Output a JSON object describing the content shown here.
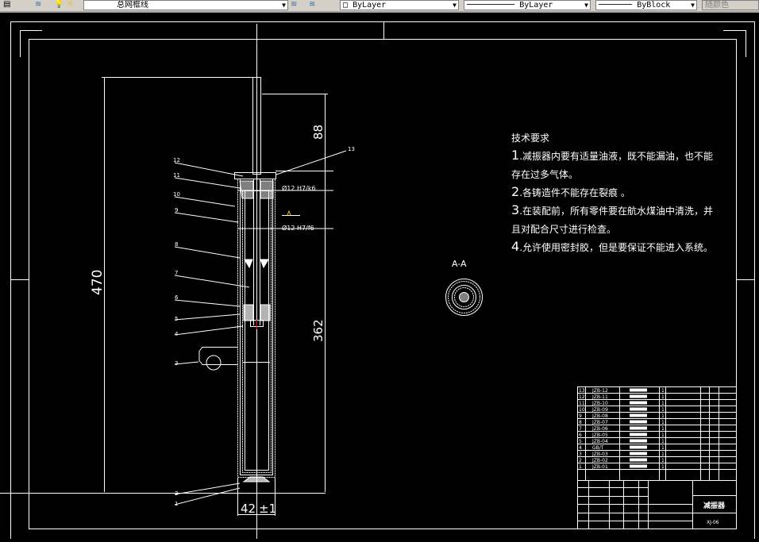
{
  "toolbar": {
    "layer_name": "总网框线",
    "color": "ByLayer",
    "linetype": "ByLayer",
    "lineweight": "ByBlock",
    "plot_style": "随颜色"
  },
  "drawing": {
    "dims": {
      "overall": "470",
      "top": "88",
      "bottom": "362",
      "diameter": "42",
      "tolerance": "±1"
    },
    "fits": {
      "fit1": "Ø12 H7/k6",
      "fit2": "Ø12 H7/f6"
    },
    "section_label": "A-A",
    "balloons": [
      "1",
      "2",
      "3",
      "4",
      "5",
      "6",
      "7",
      "8",
      "9",
      "10",
      "11",
      "12",
      "13"
    ],
    "tech_requirements": {
      "title": "技术要求",
      "items": [
        {
          "num": "1",
          "text": ".减振器内要有适量油液，既不能漏油，也不能"
        },
        {
          "num": "",
          "text": "存在过多气体。"
        },
        {
          "num": "2",
          "text": ".各铸造件不能存在裂痕 。"
        },
        {
          "num": "3",
          "text": ".在装配前，所有零件要在航水煤油中清洗，并"
        },
        {
          "num": "",
          "text": "且对配合尺寸进行检查。"
        },
        {
          "num": "4",
          "text": ".允许使用密封胶，但是要保证不能进入系统。"
        }
      ]
    }
  },
  "title_block": {
    "title": "减振器",
    "drawing_no": "XJ-06",
    "parts": [
      {
        "no": "13",
        "code": "JZB-12",
        "qty": "1"
      },
      {
        "no": "12",
        "code": "JZB-11",
        "qty": "1"
      },
      {
        "no": "11",
        "code": "JZB-10",
        "qty": "1"
      },
      {
        "no": "10",
        "code": "JZB-09",
        "qty": "1"
      },
      {
        "no": "9",
        "code": "JZB-08",
        "qty": "1"
      },
      {
        "no": "8",
        "code": "JZB-07",
        "qty": "1"
      },
      {
        "no": "7",
        "code": "JZB-06",
        "qty": "1"
      },
      {
        "no": "6",
        "code": "JZB-05",
        "qty": "1"
      },
      {
        "no": "5",
        "code": "JZB-04",
        "qty": "1"
      },
      {
        "no": "4",
        "code": "GB/T",
        "qty": "1"
      },
      {
        "no": "3",
        "code": "JZB-03",
        "qty": "1"
      },
      {
        "no": "2",
        "code": "JZB-02",
        "qty": "1"
      },
      {
        "no": "1",
        "code": "JZB-01",
        "qty": "1"
      }
    ]
  },
  "colors": {
    "background": "#000000",
    "lines": "#ffffff",
    "toolbar": "#d4d0c8",
    "center_mark": "#ff0000"
  }
}
